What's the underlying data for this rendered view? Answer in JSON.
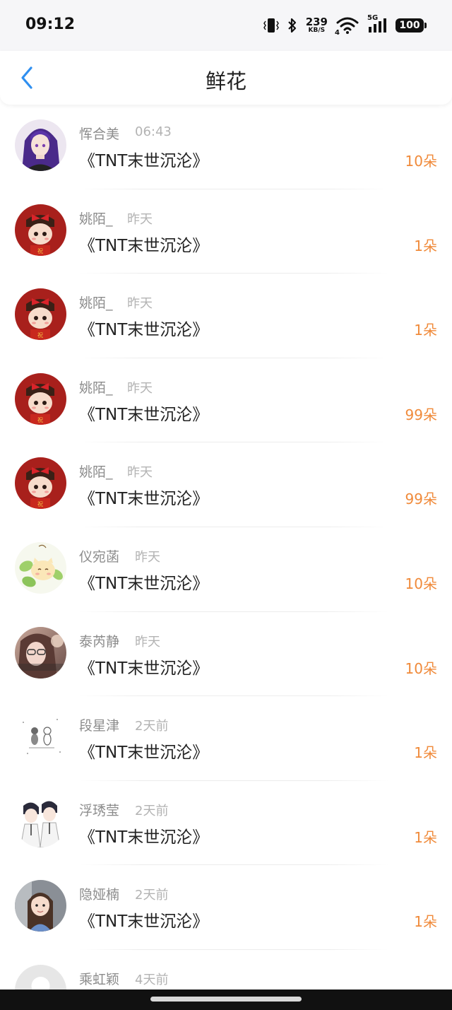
{
  "status_bar": {
    "time": "09:12",
    "net_speed_value": "239",
    "net_speed_unit": "KB/S",
    "network_type": "5G",
    "wifi_sub": "4",
    "battery": "100",
    "icons": [
      "vibrate-icon",
      "bluetooth-icon",
      "wifi-icon",
      "signal-icon",
      "battery-icon"
    ]
  },
  "nav": {
    "back_icon": "chevron-left-icon",
    "title": "鲜花"
  },
  "colors": {
    "accent_blue": "#2f8ff0",
    "count_orange": "#f08a3a"
  },
  "items": [
    {
      "name": "恽合美",
      "time": "06:43",
      "book": "《TNT末世沉沦》",
      "count": "10朵",
      "avatar": "purple-hair-girl-avatar"
    },
    {
      "name": "姚陌_",
      "time": "昨天",
      "book": "《TNT末世沉沦》",
      "count": "1朵",
      "avatar": "red-bow-girl-avatar"
    },
    {
      "name": "姚陌_",
      "time": "昨天",
      "book": "《TNT末世沉沦》",
      "count": "1朵",
      "avatar": "red-bow-girl-avatar"
    },
    {
      "name": "姚陌_",
      "time": "昨天",
      "book": "《TNT末世沉沦》",
      "count": "99朵",
      "avatar": "red-bow-girl-avatar"
    },
    {
      "name": "姚陌_",
      "time": "昨天",
      "book": "《TNT末世沉沦》",
      "count": "99朵",
      "avatar": "red-bow-girl-avatar"
    },
    {
      "name": "仪宛菡",
      "time": "昨天",
      "book": "《TNT末世沉沦》",
      "count": "10朵",
      "avatar": "cartoon-cat-leaf-avatar"
    },
    {
      "name": "泰芮静",
      "time": "昨天",
      "book": "《TNT末世沉沦》",
      "count": "10朵",
      "avatar": "girl-photo-avatar"
    },
    {
      "name": "段星津",
      "time": "2天前",
      "book": "《TNT末世沉沦》",
      "count": "1朵",
      "avatar": "sketch-figures-avatar"
    },
    {
      "name": "浮琇莹",
      "time": "2天前",
      "book": "《TNT末世沉沦》",
      "count": "1朵",
      "avatar": "anime-couple-avatar"
    },
    {
      "name": "隐娅楠",
      "time": "2天前",
      "book": "《TNT末世沉沦》",
      "count": "1朵",
      "avatar": "child-photo-avatar"
    },
    {
      "name": "乘虹颖",
      "time": "4天前",
      "book": "",
      "count": "",
      "avatar": "default-gray-avatar"
    }
  ]
}
